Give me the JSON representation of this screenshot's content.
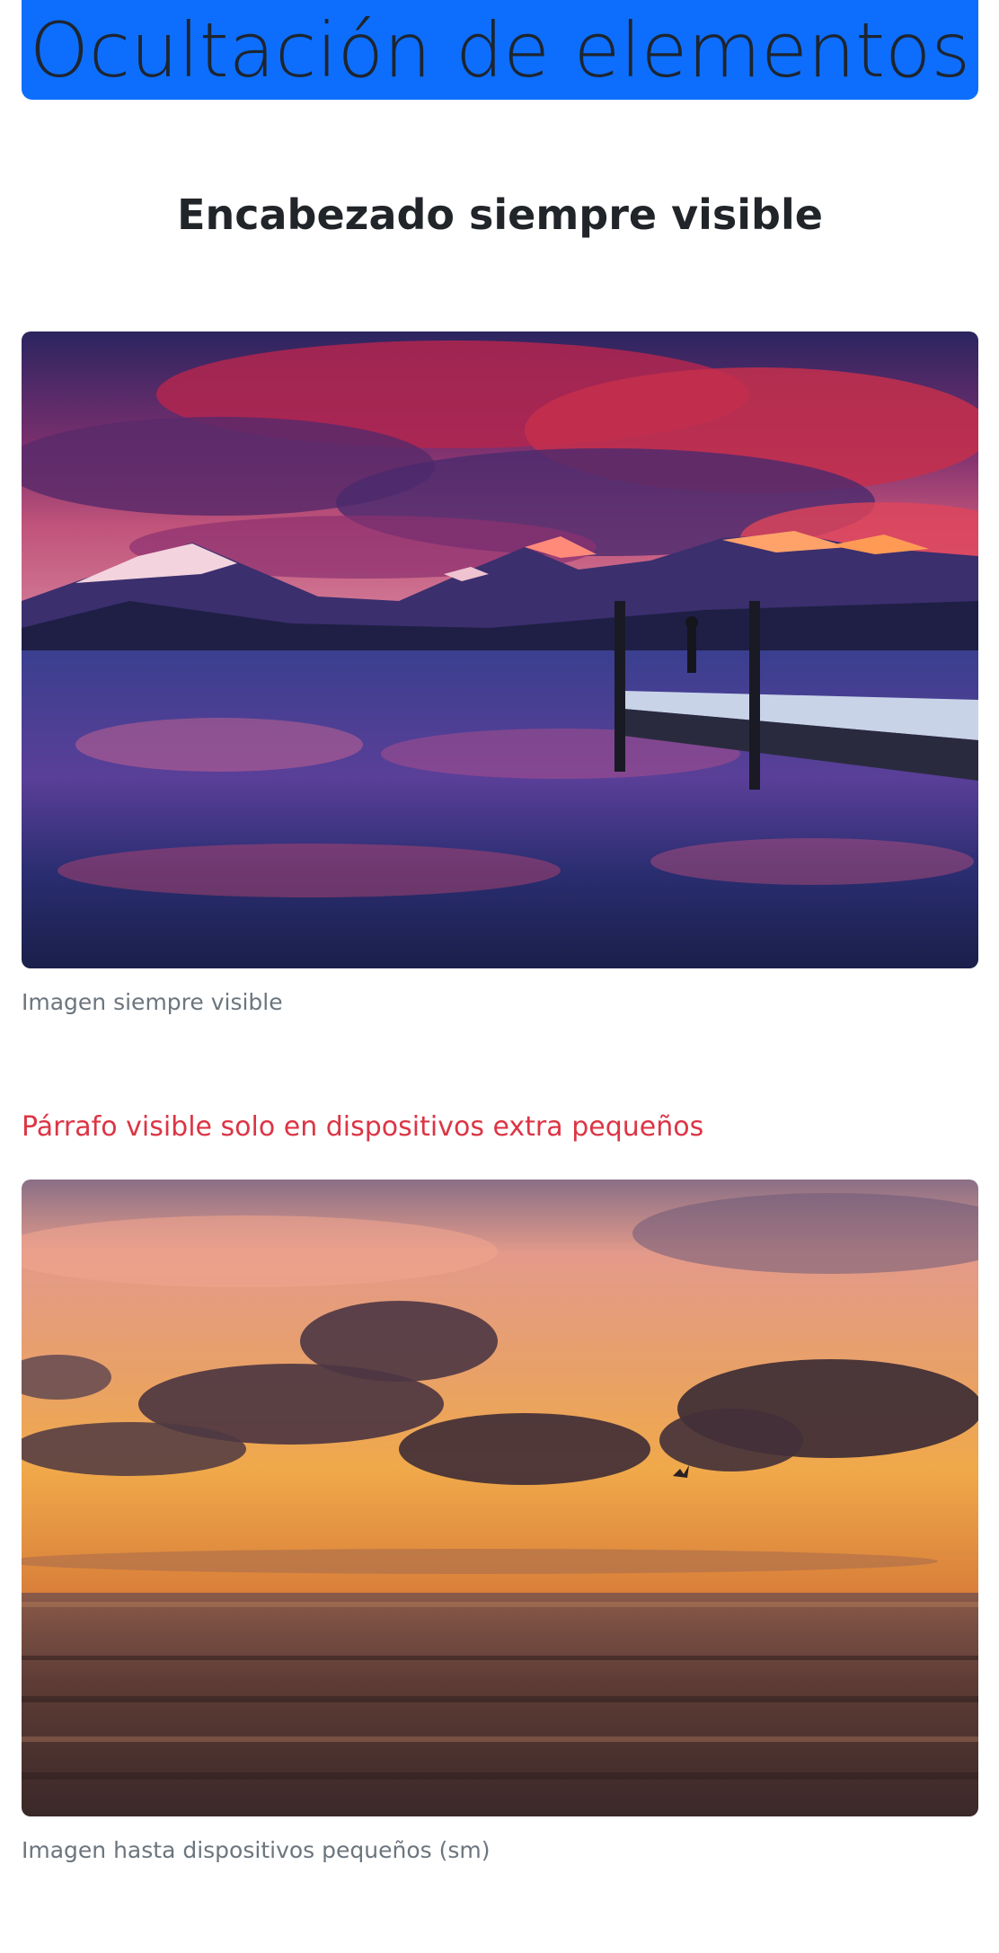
{
  "banner": {
    "title": "Ocultación de elementos"
  },
  "heading": {
    "text": "Encabezado siempre visible"
  },
  "figure1": {
    "caption": "Imagen siempre visible"
  },
  "notice": {
    "text": "Párrafo visible solo en dispositivos extra pequeños"
  },
  "figure2": {
    "caption": "Imagen hasta dispositivos pequeños (sm)"
  },
  "colors": {
    "banner": "#0d6efd",
    "notice": "#dc3545",
    "caption": "#6c757d"
  }
}
